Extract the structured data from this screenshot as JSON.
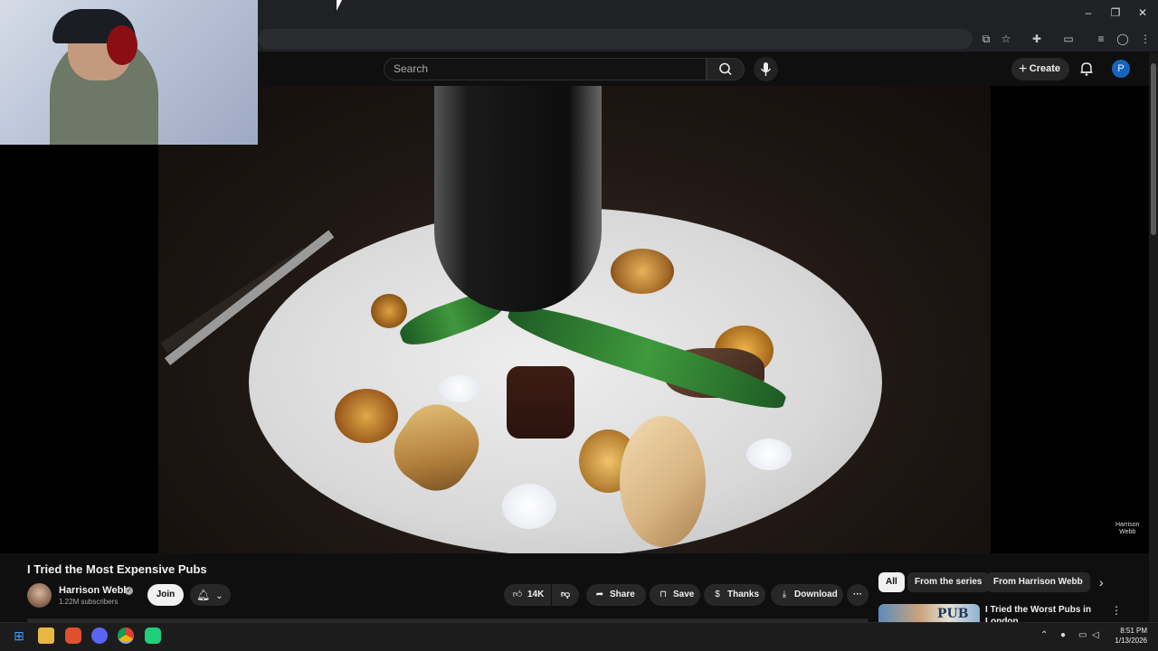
{
  "browser": {
    "window_controls": [
      "minimize-icon",
      "restore-icon",
      "close-icon"
    ],
    "toolbar_icons": [
      "cast-icon",
      "star-icon",
      "extensions-icon",
      "sidepanel-icon",
      "media-icon",
      "profile-icon",
      "more-icon"
    ]
  },
  "header": {
    "search_placeholder": "Search",
    "create_label": "Create",
    "avatar_letter": "P",
    "avatar_color": "#1565c0"
  },
  "video": {
    "watermark": "Harrison\nWebb"
  },
  "info": {
    "title": "I Tried the Most Expensive Pubs",
    "channel_name": "Harrison Webb",
    "subscribers": "1.22M subscribers",
    "join_label": "Join",
    "like_count": "14K",
    "share_label": "Share",
    "save_label": "Save",
    "thanks_label": "Thanks",
    "download_label": "Download"
  },
  "sidebar": {
    "chips": [
      "All",
      "From the series",
      "From Harrison Webb"
    ],
    "reco": {
      "thumb_text": "PUB",
      "title": "I Tried the Worst Pubs in London"
    }
  },
  "taskbar": {
    "apps": [
      "windows-start-icon",
      "file-explorer-icon",
      "brave-icon",
      "discord-icon",
      "chrome-icon",
      "app-icon"
    ],
    "time": "8:51 PM",
    "date": "1/13/2026"
  }
}
